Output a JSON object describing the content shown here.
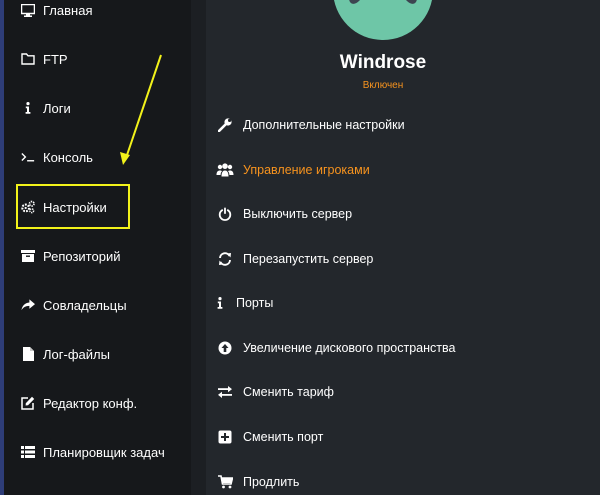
{
  "sidebar": {
    "items": [
      {
        "label": "Главная",
        "icon": "monitor-icon"
      },
      {
        "label": "FTP",
        "icon": "folder-icon"
      },
      {
        "label": "Логи",
        "icon": "info-icon"
      },
      {
        "label": "Консоль",
        "icon": "terminal-icon"
      },
      {
        "label": "Настройки",
        "icon": "gears-icon"
      },
      {
        "label": "Репозиторий",
        "icon": "archive-icon"
      },
      {
        "label": "Совладельцы",
        "icon": "share-icon"
      },
      {
        "label": "Лог-файлы",
        "icon": "file-icon"
      },
      {
        "label": "Редактор конф.",
        "icon": "edit-icon"
      },
      {
        "label": "Планировщик задач",
        "icon": "list-icon"
      }
    ]
  },
  "server": {
    "name": "Windrose",
    "status": "Включен",
    "avatar_icon": "gamepad-icon"
  },
  "menu": {
    "items": [
      {
        "label": "Дополнительные настройки",
        "icon": "wrench-icon"
      },
      {
        "label": "Управление игроками",
        "icon": "users-icon"
      },
      {
        "label": "Выключить сервер",
        "icon": "power-icon"
      },
      {
        "label": "Перезапустить сервер",
        "icon": "refresh-icon"
      },
      {
        "label": "Порты",
        "icon": "info-icon"
      },
      {
        "label": "Увеличение дискового пространства",
        "icon": "arrow-up-circle-icon"
      },
      {
        "label": "Сменить тариф",
        "icon": "exchange-icon"
      },
      {
        "label": "Сменить порт",
        "icon": "plus-square-icon"
      },
      {
        "label": "Продлить",
        "icon": "cart-icon"
      }
    ]
  },
  "colors": {
    "accent": "#f7931e",
    "annotation": "#f2f21a",
    "sidebar_bg": "#16181b",
    "main_bg": "#23272c",
    "avatar_bg": "#6ec6a7"
  }
}
